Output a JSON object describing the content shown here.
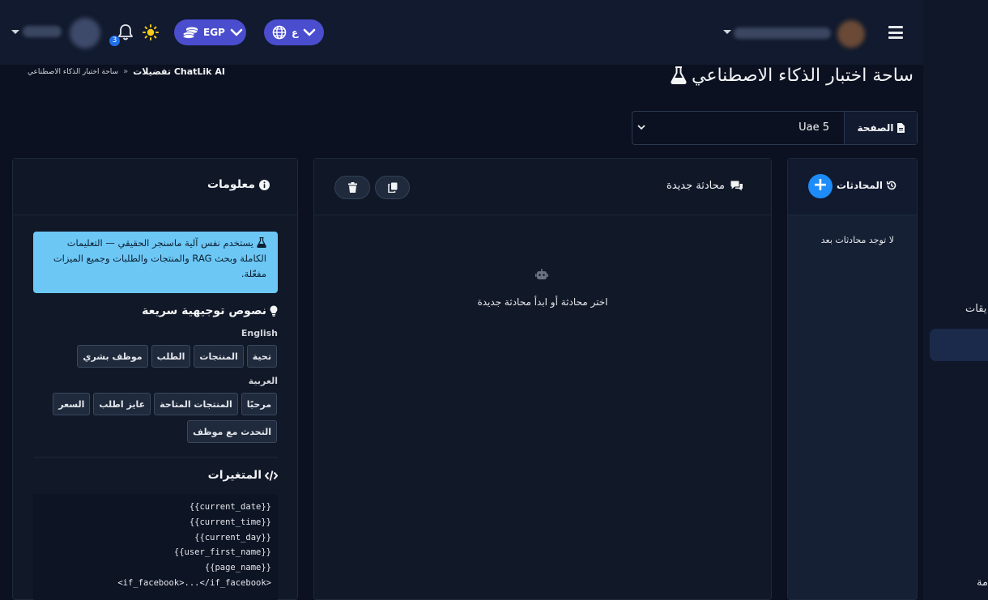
{
  "topbar": {
    "notifications_count": "3",
    "currency_label": "EGP",
    "language_label": "ع"
  },
  "page": {
    "title": "ساحة اختبار الذكاء الاصطناعي",
    "breadcrumb": {
      "link": "تفضيلات ChatLik AI",
      "separator": "»",
      "current": "ساحة اختبار الذكاء الاصطناعي"
    }
  },
  "page_select": {
    "label": "الصفحة",
    "value": "Uae 5"
  },
  "conversations": {
    "title": "المحادثات",
    "add_label": "+",
    "empty_text": "لا توجد محادثات بعد"
  },
  "chat": {
    "title": "محادثة جديدة",
    "empty_text": "اختر محادثة أو ابدأ محادثة جديدة"
  },
  "info": {
    "title": "معلومات",
    "alert_text": "يستخدم نفس آلية ماسنجر الحقيقي — التعليمات الكاملة وبحث RAG والمنتجات والطلبات وجميع الميزات مفعّلة.",
    "prompts_title": "نصوص توجيهية سريعة",
    "english_label": "English",
    "english_chips": [
      "تحية",
      "المنتجات",
      "الطلب",
      "موظف بشري"
    ],
    "arabic_label": "العربية",
    "arabic_chips_row1": [
      "مرحبًا",
      "المنتجات المتاحة",
      "عايز اطلب",
      "السعر"
    ],
    "arabic_chips_row2": [
      "التحدث مع موظف"
    ],
    "variables_title": "المتغيرات",
    "variables": [
      "{{current_date}}",
      "{{current_time}}",
      "{{current_day}}",
      "{{user_first_name}}",
      "{{page_name}}",
      "<if_facebook>...</if_facebook>"
    ]
  },
  "sidebar": {
    "partial_item_1": "يقات",
    "partial_item_2": "مة"
  },
  "colors": {
    "accent": "#4a4dce",
    "primary_button": "#1d8cf8",
    "info_alert": "#6cc7f5",
    "background": "#0b1120"
  }
}
